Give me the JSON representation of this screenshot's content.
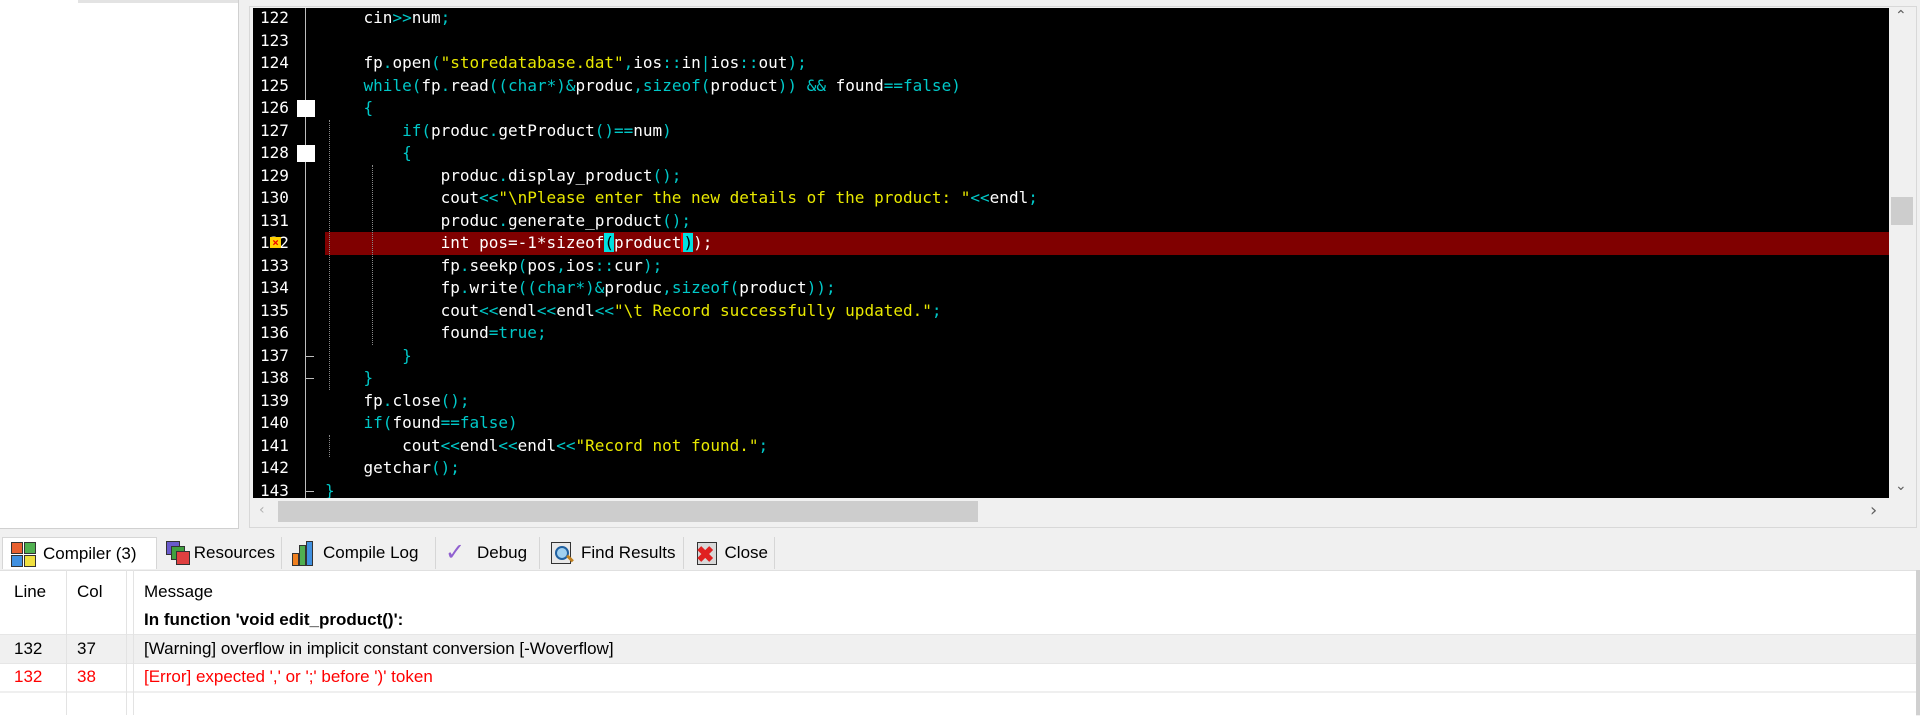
{
  "editor": {
    "lines": [
      {
        "num": "122",
        "html": "    cin<span class='op'>&gt;&gt;</span>num<span class='op'>;</span>"
      },
      {
        "num": "123",
        "html": ""
      },
      {
        "num": "124",
        "html": "    fp<span class='op'>.</span>open<span class='op'>(</span><span class='str'>\"storedatabase.dat\"</span><span class='op'>,</span>ios<span class='op'>::</span>in<span class='op'>|</span>ios<span class='op'>::</span>out<span class='op'>);</span>"
      },
      {
        "num": "125",
        "html": "    <span class='kw'>while</span><span class='op'>(</span>fp<span class='op'>.</span>read<span class='op'>((</span><span class='kw'>char</span><span class='op'>*)&amp;</span>produc<span class='op'>,</span><span class='kw'>sizeof</span><span class='op'>(</span>product<span class='op'>)) &amp;&amp;</span> found<span class='op'>==</span><span class='kw'>false</span><span class='op'>)</span>"
      },
      {
        "num": "126",
        "html": "    <span class='op'>{</span>"
      },
      {
        "num": "127",
        "html": "        <span class='kw'>if</span><span class='op'>(</span>produc<span class='op'>.</span>getProduct<span class='op'>()==</span>num<span class='op'>)</span>"
      },
      {
        "num": "128",
        "html": "        <span class='op'>{</span>"
      },
      {
        "num": "129",
        "html": "            produc<span class='op'>.</span>display_product<span class='op'>();</span>"
      },
      {
        "num": "130",
        "html": "            cout<span class='op'>&lt;&lt;</span><span class='str'>\"\\nPlease enter the new details of the product: \"</span><span class='op'>&lt;&lt;</span>endl<span class='op'>;</span>"
      },
      {
        "num": "131",
        "html": "            produc<span class='op'>.</span>generate_product<span class='op'>();</span>"
      },
      {
        "num": "132",
        "html": "            int pos=-1*sizeof<span class='brkt'>(</span>product<span style='border-right:2px solid #f00'></span><span class='brkt'>)</span>);"
      },
      {
        "num": "133",
        "html": "            fp<span class='op'>.</span>seekp<span class='op'>(</span>pos<span class='op'>,</span>ios<span class='op'>::</span>cur<span class='op'>);</span>"
      },
      {
        "num": "134",
        "html": "            fp<span class='op'>.</span>write<span class='op'>((</span><span class='kw'>char</span><span class='op'>*)&amp;</span>produc<span class='op'>,</span><span class='kw'>sizeof</span><span class='op'>(</span>product<span class='op'>));</span>"
      },
      {
        "num": "135",
        "html": "            cout<span class='op'>&lt;&lt;</span>endl<span class='op'>&lt;&lt;</span>endl<span class='op'>&lt;&lt;</span><span class='str'>\"\\t Record successfully updated.\"</span><span class='op'>;</span>"
      },
      {
        "num": "136",
        "html": "            found<span class='op'>=</span><span class='kw'>true</span><span class='op'>;</span>"
      },
      {
        "num": "137",
        "html": "        <span class='op'>}</span>"
      },
      {
        "num": "138",
        "html": "    <span class='op'>}</span>"
      },
      {
        "num": "139",
        "html": "    fp<span class='op'>.</span>close<span class='op'>();</span>"
      },
      {
        "num": "140",
        "html": "    <span class='kw'>if</span><span class='op'>(</span>found<span class='op'>==</span><span class='kw'>false</span><span class='op'>)</span>"
      },
      {
        "num": "141",
        "html": "        cout<span class='op'>&lt;&lt;</span>endl<span class='op'>&lt;&lt;</span>endl<span class='op'>&lt;&lt;</span><span class='str'>\"Record not found.\"</span><span class='op'>;</span>"
      },
      {
        "num": "142",
        "html": "    getchar<span class='op'>();</span>"
      },
      {
        "num": "143",
        "html": "<span class='op'>}</span>"
      }
    ],
    "error_line": "132",
    "fold_open_lines": [
      "126",
      "128"
    ],
    "fold_end_lines": [
      "137",
      "138",
      "143"
    ],
    "colors": {
      "background": "#000000",
      "error_line": "#800000",
      "keyword": "#00c8c8",
      "string": "#e8e800"
    }
  },
  "tabs": [
    {
      "label": "Compiler (3)",
      "icon": "compiler-icon",
      "active": true
    },
    {
      "label": "Resources",
      "icon": "resources-icon",
      "active": false
    },
    {
      "label": "Compile Log",
      "icon": "compile-log-icon",
      "active": false
    },
    {
      "label": "Debug",
      "icon": "debug-icon",
      "active": false
    },
    {
      "label": "Find Results",
      "icon": "find-results-icon",
      "active": false
    },
    {
      "label": "Close",
      "icon": "close-icon",
      "active": false
    }
  ],
  "messages": {
    "headers": {
      "line": "Line",
      "col": "Col",
      "message": "Message"
    },
    "rows": [
      {
        "line": "",
        "col": "",
        "message": "In function 'void edit_product()':",
        "type": "info"
      },
      {
        "line": "132",
        "col": "37",
        "message": "[Warning] overflow in implicit constant conversion [-Woverflow]",
        "type": "warning"
      },
      {
        "line": "132",
        "col": "38",
        "message": "[Error] expected ',' or ';' before ')' token",
        "type": "error"
      }
    ],
    "colors": {
      "error": "#ff0000",
      "selected_row": "#f0f0f0"
    }
  }
}
